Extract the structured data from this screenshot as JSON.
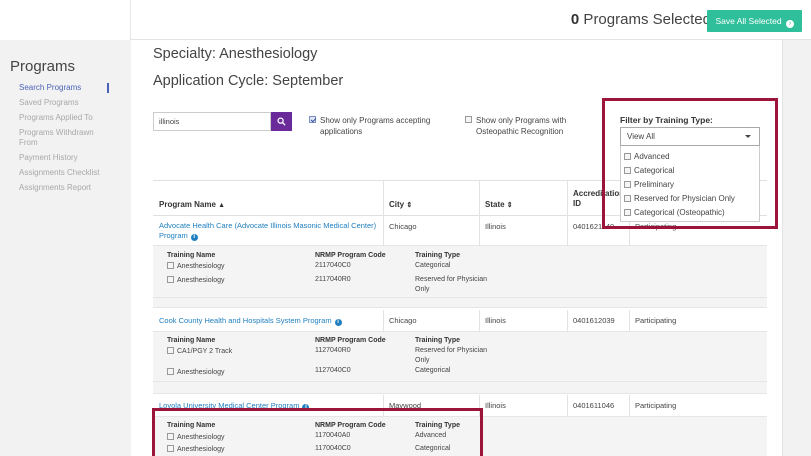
{
  "header": {
    "selected_count": "0",
    "selected_label": " Programs Selected",
    "save_button": "Save All Selected",
    "save_icon": "arrow-right-circle-icon"
  },
  "sidebar": {
    "title": "Programs",
    "items": [
      {
        "label": "Search Programs"
      },
      {
        "label": "Saved Programs"
      },
      {
        "label": "Programs Applied To"
      },
      {
        "label": "Programs Withdrawn From"
      },
      {
        "label": "Payment History"
      },
      {
        "label": "Assignments Checklist"
      },
      {
        "label": "Assignments Report"
      }
    ]
  },
  "main": {
    "specialty": "Specialty: Anesthesiology",
    "cycle": "Application Cycle: September",
    "search": {
      "value": "illinois"
    },
    "accepting_label": "Show only Programs accepting applications",
    "osteo_label": "Show only Programs with Osteopathic Recognition",
    "filter": {
      "label": "Filter by Training Type:",
      "selected": "View All",
      "options": [
        "Advanced",
        "Categorical",
        "Preliminary",
        "Reserved for Physician Only",
        "Categorical (Osteopathic)"
      ]
    },
    "columns": {
      "program_name": "Program Name",
      "city": "City",
      "state": "State",
      "accreditation": "Accreditation ID"
    },
    "detail_headers": {
      "training_name": "Training Name",
      "nrmp_code": "NRMP Program Code",
      "training_type": "Training Type"
    },
    "programs": [
      {
        "name": "Advocate Health Care (Advocate Illinois Masonic Medical Center) Program",
        "city": "Chicago",
        "state": "Illinois",
        "accreditation_id": "0401621140",
        "status": "Participating",
        "tracks": [
          {
            "name": "Anesthesiology",
            "code": "2117040C0",
            "type": "Categorical"
          },
          {
            "name": "Anesthesiology",
            "code": "2117040R0",
            "type": "Reserved for Physician Only"
          }
        ]
      },
      {
        "name": "Cook County Health and Hospitals System Program",
        "city": "Chicago",
        "state": "Illinois",
        "accreditation_id": "0401612039",
        "status": "Participating",
        "tracks": [
          {
            "name": "CA1/PGY 2 Track",
            "code": "1127040R0",
            "type": "Reserved for Physician Only"
          },
          {
            "name": "Anesthesiology",
            "code": "1127040C0",
            "type": "Categorical"
          }
        ]
      },
      {
        "name": "Loyola University Medical Center Program",
        "city": "Maywood",
        "state": "Illinois",
        "accreditation_id": "0401611046",
        "status": "Participating",
        "tracks": [
          {
            "name": "Anesthesiology",
            "code": "1170040A0",
            "type": "Advanced"
          },
          {
            "name": "Anesthesiology",
            "code": "1170040C0",
            "type": "Categorical"
          }
        ]
      }
    ]
  },
  "colors": {
    "accent": "#2fbf9b",
    "search_button": "#6a2a9a",
    "link": "#1f7fc0",
    "highlight": "#9c1439"
  }
}
